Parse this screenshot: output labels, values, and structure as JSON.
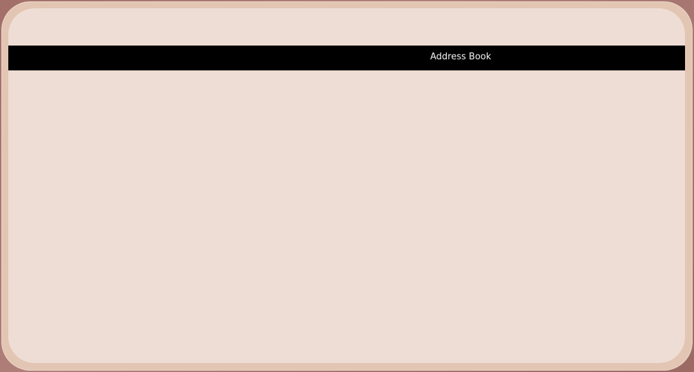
{
  "app": {
    "title": "Address Book"
  },
  "colors": {
    "background": "#a26f68",
    "frame": "#e2c5b2",
    "panel": "#eeddd4",
    "title_bar": "#000000",
    "title_text": "#f4f4f4"
  }
}
